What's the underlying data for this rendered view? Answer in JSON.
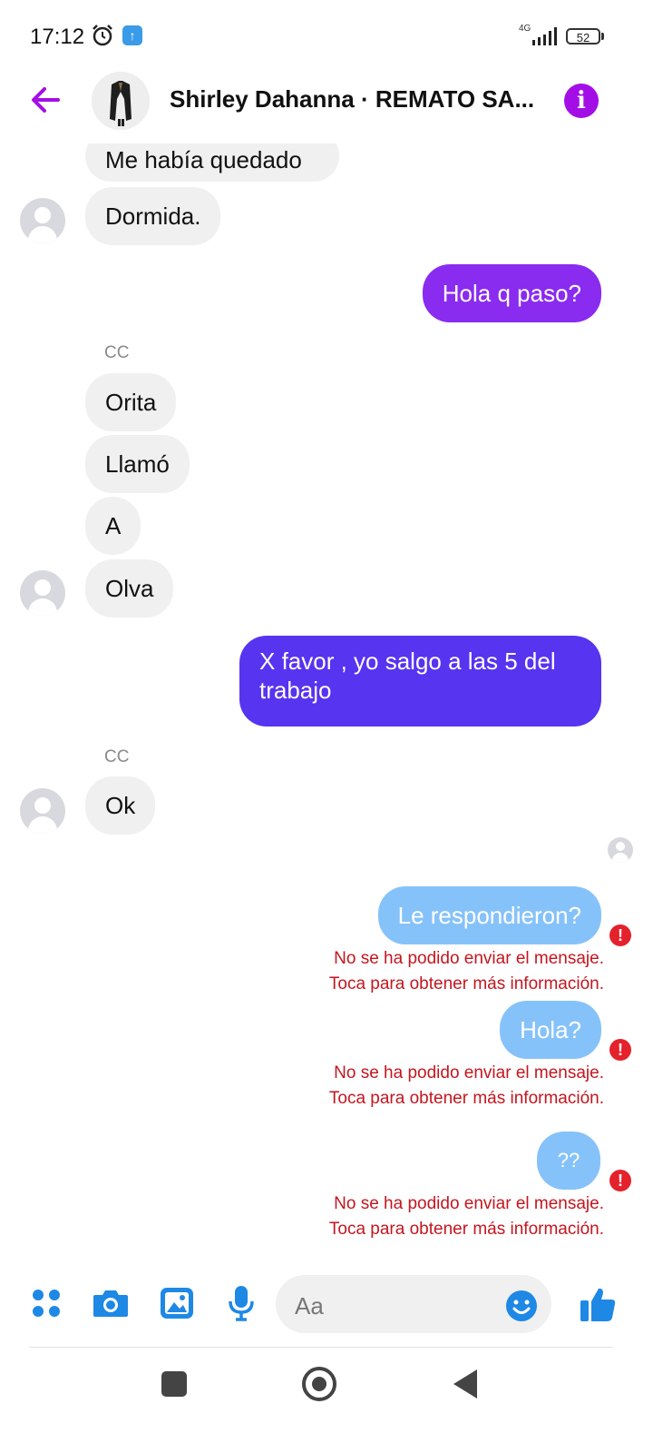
{
  "status_bar": {
    "time": "17:12",
    "network": "4G",
    "battery": "52"
  },
  "header": {
    "title": "Shirley Dahanna · REMATO SA..."
  },
  "messages": {
    "m0": "Me había quedado",
    "m1": "Dormida.",
    "m2": "Hola q paso?",
    "s1": "CC",
    "m3": "Orita",
    "m4": "Llamó",
    "m5": "A",
    "m6": "Olva",
    "m7_line1": "X favor , yo salgo a las 5 del",
    "m7_line2": "trabajo",
    "s2": "CC",
    "m8": "Ok",
    "m9": "Le respondieron?",
    "m10": "Hola?",
    "m11": "??"
  },
  "errors": {
    "line1": "No se ha podido enviar el mensaje.",
    "line2": "Toca para obtener más información."
  },
  "composer": {
    "placeholder": "Aa"
  },
  "colors": {
    "purple_bubble": "#8a2bf0",
    "indigo_bubble": "#5634f0",
    "failed_bubble": "#86c2fa",
    "accent": "#a30ee6",
    "messenger_blue": "#1e88e5",
    "error_red": "#c4161f"
  }
}
